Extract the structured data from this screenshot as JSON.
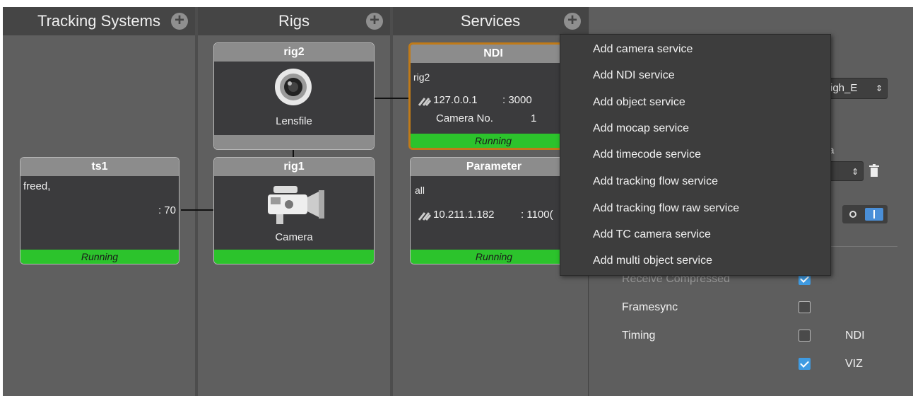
{
  "columns": {
    "tracking_systems": {
      "title": "Tracking Systems"
    },
    "rigs": {
      "title": "Rigs"
    },
    "services": {
      "title": "Services"
    }
  },
  "nodes": {
    "ts1": {
      "title": "ts1",
      "line1": "freed,",
      "port": ": 70",
      "status": "Running"
    },
    "rig2": {
      "title": "rig2",
      "icon_label": "Lensfile",
      "icon": "lens-icon"
    },
    "rig1": {
      "title": "rig1",
      "icon_label": "Camera",
      "icon": "camera-icon"
    },
    "ndi": {
      "title": "NDI",
      "rig": "rig2",
      "ip": "127.0.0.1",
      "port": ": 3000",
      "camera_label": "Camera No.",
      "camera_no": "1",
      "status": "Running"
    },
    "parameter": {
      "title": "Parameter",
      "scope": "all",
      "ip": "10.211.1.182",
      "port": ": 1100(",
      "status": "Running"
    }
  },
  "context_menu": {
    "items": [
      "Add camera service",
      "Add NDI service",
      "Add object service",
      "Add mocap service",
      "Add timecode service",
      "Add tracking flow service",
      "Add tracking flow raw service",
      "Add TC camera service",
      "Add multi object service"
    ]
  },
  "panel": {
    "dropdown1_value": "igh_E",
    "partial_label": "ra",
    "receive_compressed": {
      "label": "Receive Compressed",
      "checked": true
    },
    "framesync": {
      "label": "Framesync",
      "checked": false
    },
    "timing": {
      "label": "Timing",
      "checked": false,
      "right_label": "NDI"
    },
    "viz": {
      "checked": true,
      "right_label": "VIZ"
    }
  },
  "colors": {
    "running": "#2cc32c",
    "selected_border": "#c07a18",
    "checkbox_checked": "#3f9be2"
  }
}
